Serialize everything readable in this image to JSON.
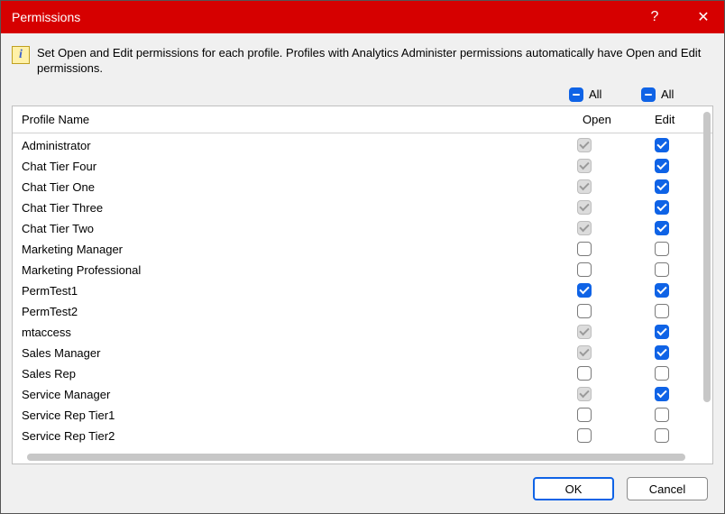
{
  "window": {
    "title": "Permissions",
    "help_glyph": "?",
    "close_glyph": "✕"
  },
  "info": {
    "glyph": "i",
    "text": "Set Open and Edit permissions for each profile. Profiles with Analytics Administer permissions automatically have Open and Edit permissions."
  },
  "all": {
    "open_label": "All",
    "edit_label": "All",
    "open_state": "partial",
    "edit_state": "partial"
  },
  "columns": {
    "name": "Profile Name",
    "open": "Open",
    "edit": "Edit"
  },
  "rows": [
    {
      "name": "Administrator",
      "open": "disabled-checked",
      "edit": "checked"
    },
    {
      "name": "Chat Tier Four",
      "open": "disabled-checked",
      "edit": "checked"
    },
    {
      "name": "Chat Tier One",
      "open": "disabled-checked",
      "edit": "checked"
    },
    {
      "name": "Chat Tier Three",
      "open": "disabled-checked",
      "edit": "checked"
    },
    {
      "name": "Chat Tier Two",
      "open": "disabled-checked",
      "edit": "checked"
    },
    {
      "name": "Marketing Manager",
      "open": "unchecked",
      "edit": "unchecked"
    },
    {
      "name": "Marketing Professional",
      "open": "unchecked",
      "edit": "unchecked"
    },
    {
      "name": "PermTest1",
      "open": "checked",
      "edit": "checked"
    },
    {
      "name": "PermTest2",
      "open": "unchecked",
      "edit": "unchecked"
    },
    {
      "name": "mtaccess",
      "open": "disabled-checked",
      "edit": "checked"
    },
    {
      "name": "Sales Manager",
      "open": "disabled-checked",
      "edit": "checked"
    },
    {
      "name": "Sales Rep",
      "open": "unchecked",
      "edit": "unchecked"
    },
    {
      "name": "Service Manager",
      "open": "disabled-checked",
      "edit": "checked"
    },
    {
      "name": "Service Rep Tier1",
      "open": "unchecked",
      "edit": "unchecked"
    },
    {
      "name": "Service Rep Tier2",
      "open": "unchecked",
      "edit": "unchecked"
    }
  ],
  "buttons": {
    "ok": "OK",
    "cancel": "Cancel"
  }
}
